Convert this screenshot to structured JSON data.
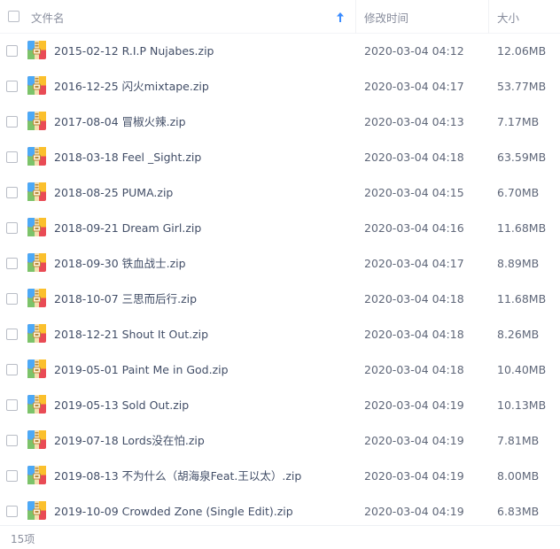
{
  "header": {
    "name_label": "文件名",
    "time_label": "修改时间",
    "size_label": "大小",
    "sort_icon": "arrow-up-icon",
    "sort_color": "#3b8cff"
  },
  "files": [
    {
      "name": "2015-02-12 R.I.P Nujabes.zip",
      "time": "2020-03-04 04:12",
      "size": "12.06MB"
    },
    {
      "name": "2016-12-25 闪火mixtape.zip",
      "time": "2020-03-04 04:17",
      "size": "53.77MB"
    },
    {
      "name": "2017-08-04 冒椒火辣.zip",
      "time": "2020-03-04 04:13",
      "size": "7.17MB"
    },
    {
      "name": "2018-03-18 Feel _Sight.zip",
      "time": "2020-03-04 04:18",
      "size": "63.59MB"
    },
    {
      "name": "2018-08-25 PUMA.zip",
      "time": "2020-03-04 04:15",
      "size": "6.70MB"
    },
    {
      "name": "2018-09-21 Dream Girl.zip",
      "time": "2020-03-04 04:16",
      "size": "11.68MB"
    },
    {
      "name": "2018-09-30 铁血战士.zip",
      "time": "2020-03-04 04:17",
      "size": "8.89MB"
    },
    {
      "name": "2018-10-07 三思而后行.zip",
      "time": "2020-03-04 04:18",
      "size": "11.68MB"
    },
    {
      "name": "2018-12-21 Shout It Out.zip",
      "time": "2020-03-04 04:18",
      "size": "8.26MB"
    },
    {
      "name": "2019-05-01 Paint Me in God.zip",
      "time": "2020-03-04 04:18",
      "size": "10.40MB"
    },
    {
      "name": "2019-05-13 Sold Out.zip",
      "time": "2020-03-04 04:19",
      "size": "10.13MB"
    },
    {
      "name": "2019-07-18 Lords没在怕.zip",
      "time": "2020-03-04 04:19",
      "size": "7.81MB"
    },
    {
      "name": "2019-08-13 不为什么（胡海泉Feat.王以太）.zip",
      "time": "2020-03-04 04:19",
      "size": "8.00MB"
    },
    {
      "name": "2019-10-09 Crowded Zone (Single Edit).zip",
      "time": "2020-03-04 04:19",
      "size": "6.83MB"
    }
  ],
  "file_icon": "zip-archive-icon",
  "footer": {
    "count_label": "15项"
  }
}
